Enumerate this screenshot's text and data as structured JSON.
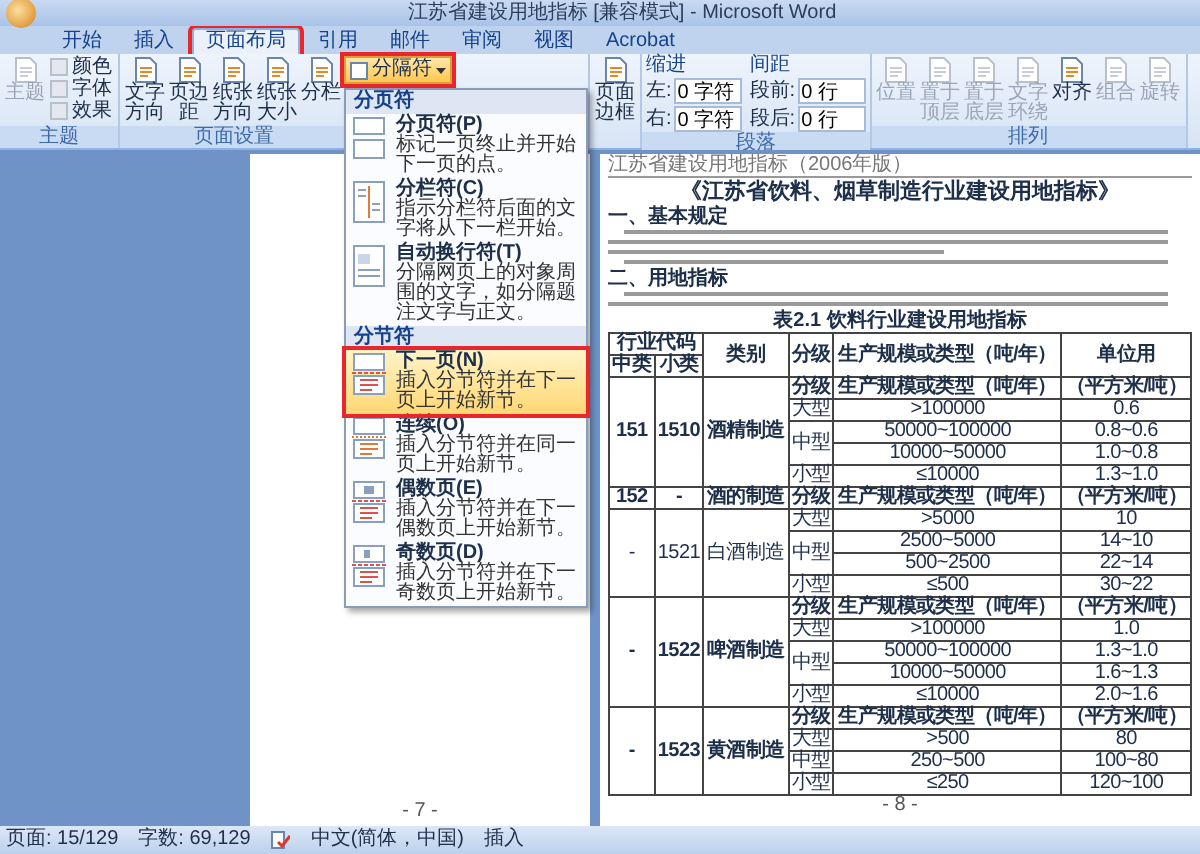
{
  "window": {
    "title": "江苏省建设用地指标 [兼容模式] - Microsoft Word"
  },
  "tabs": [
    {
      "label": "开始",
      "selected": false,
      "callout": false
    },
    {
      "label": "插入",
      "selected": false,
      "callout": false
    },
    {
      "label": "页面布局",
      "selected": true,
      "callout": true
    },
    {
      "label": "引用",
      "selected": false,
      "callout": false
    },
    {
      "label": "邮件",
      "selected": false,
      "callout": false
    },
    {
      "label": "审阅",
      "selected": false,
      "callout": false
    },
    {
      "label": "视图",
      "selected": false,
      "callout": false
    },
    {
      "label": "Acrobat",
      "selected": false,
      "callout": false
    }
  ],
  "ribbon": {
    "groups": [
      {
        "kind": "buttons",
        "label": "主题",
        "buttons": [
          {
            "kind": "big",
            "label": "主题",
            "disabled": true
          },
          {
            "kind": "small",
            "label": "颜色",
            "disabled": true
          },
          {
            "kind": "small",
            "label": "字体",
            "disabled": true
          },
          {
            "kind": "small",
            "label": "效果",
            "disabled": true
          }
        ]
      },
      {
        "kind": "buttons",
        "label": "页面设置",
        "buttons": [
          {
            "kind": "big",
            "label": "文字方向",
            "disabled": false
          },
          {
            "kind": "big",
            "label": "页边距",
            "disabled": false
          },
          {
            "kind": "big",
            "label": "纸张方向",
            "disabled": false
          },
          {
            "kind": "big",
            "label": "纸张大小",
            "disabled": false
          },
          {
            "kind": "big",
            "label": "分栏",
            "disabled": false
          },
          {
            "kind": "menu",
            "label": "分隔符",
            "disabled": false,
            "expanded": true,
            "callout": true
          }
        ]
      },
      {
        "kind": "buttons",
        "buttons": [
          {
            "kind": "big",
            "label": "页面边框",
            "disabled": false
          }
        ]
      },
      {
        "kind": "paragraph",
        "label": "段落",
        "columns": [
          {
            "heading": "缩进",
            "fields": [
              {
                "label": "左:",
                "value": "0 字符"
              },
              {
                "label": "右:",
                "value": "0 字符"
              }
            ]
          },
          {
            "heading": "间距",
            "fields": [
              {
                "label": "段前:",
                "value": "0 行"
              },
              {
                "label": "段后:",
                "value": "0 行"
              }
            ]
          }
        ]
      },
      {
        "kind": "buttons",
        "label": "排列",
        "buttons": [
          {
            "kind": "big",
            "label": "位置",
            "disabled": true
          },
          {
            "kind": "big",
            "label": "置于顶层",
            "disabled": true
          },
          {
            "kind": "big",
            "label": "置于底层",
            "disabled": true
          },
          {
            "kind": "big",
            "label": "文字环绕",
            "disabled": true
          },
          {
            "kind": "big",
            "label": "对齐",
            "disabled": false
          },
          {
            "kind": "big",
            "label": "组合",
            "disabled": true
          },
          {
            "kind": "big",
            "label": "旋转",
            "disabled": true
          }
        ]
      }
    ]
  },
  "dropdown": {
    "sections": [
      {
        "heading": "分页符",
        "items": [
          {
            "kind": "page",
            "title": "分页符(P)",
            "description": "标记一页终止并开始下一页的点。",
            "selected": false,
            "callout": false
          },
          {
            "kind": "column",
            "title": "分栏符(C)",
            "description": "指示分栏符后面的文字将从下一栏开始。",
            "selected": false,
            "callout": false
          },
          {
            "kind": "wrap",
            "title": "自动换行符(T)",
            "description": "分隔网页上的对象周围的文字，如分隔题注文字与正文。",
            "selected": false,
            "callout": false
          }
        ]
      },
      {
        "heading": "分节符",
        "items": [
          {
            "kind": "next",
            "title": "下一页(N)",
            "description": "插入分节符并在下一页上开始新节。",
            "selected": true,
            "callout": true
          },
          {
            "kind": "continuous",
            "title": "连续(O)",
            "description": "插入分节符并在同一页上开始新节。",
            "selected": false,
            "callout": false
          },
          {
            "kind": "even",
            "title": "偶数页(E)",
            "description": "插入分节符并在下一偶数页上开始新节。",
            "selected": false,
            "callout": false
          },
          {
            "kind": "odd",
            "title": "奇数页(D)",
            "description": "插入分节符并在下一奇数页上开始新节。",
            "selected": false,
            "callout": false
          }
        ]
      }
    ]
  },
  "left_page": {
    "footer": "- 7 -"
  },
  "right_page": {
    "header": "江苏省建设用地指标（2006年版）",
    "title": "《江苏省饮料、烟草制造行业建设用地指标》",
    "headings": [
      "一、基本规定",
      "二、用地指标"
    ],
    "table": {
      "caption": "表2.1 饮料行业建设用地指标",
      "header": {
        "code": "行业代码",
        "middle": "中类",
        "small": "小类",
        "category": "类别",
        "grade": "分级",
        "scale": "生产规模或类型（吨/年）",
        "unit": "单位用"
      },
      "groups": [
        {
          "middle": "151",
          "small": "1510",
          "category": "酒精制造",
          "rows": [
            {
              "kind": "subheader",
              "grade": "分级",
              "scale": "生产规模或类型（吨/年）",
              "unit": "（平方米/吨）"
            },
            {
              "kind": "value",
              "grade": "大型",
              "scale": ">100000",
              "unit": "0.6"
            },
            {
              "kind": "value",
              "grade": "中型",
              "scale": "50000~100000",
              "unit": "0.8~0.6"
            },
            {
              "kind": "value",
              "scale": "10000~50000",
              "unit": "1.0~0.8"
            },
            {
              "kind": "value",
              "grade": "小型",
              "scale": "≤10000",
              "unit": "1.3~1.0"
            }
          ]
        },
        {
          "middle": "152",
          "small": "-",
          "category": "酒的制造",
          "rows": [
            {
              "kind": "subheader",
              "grade": "分级",
              "scale": "生产规模或类型（吨/年）",
              "unit": "（平方米/吨）"
            }
          ]
        },
        {
          "middle": "-",
          "small": "1521",
          "category": "白酒制造",
          "rows": [
            {
              "kind": "value",
              "grade": "大型",
              "scale": ">5000",
              "unit": "10"
            },
            {
              "kind": "value",
              "grade": "中型",
              "scale": "2500~5000",
              "unit": "14~10"
            },
            {
              "kind": "value",
              "scale": "500~2500",
              "unit": "22~14"
            },
            {
              "kind": "value",
              "grade": "小型",
              "scale": "≤500",
              "unit": "30~22"
            }
          ]
        },
        {
          "middle": "-",
          "small": "1522",
          "category": "啤酒制造",
          "rows": [
            {
              "kind": "subheader",
              "grade": "分级",
              "scale": "生产规模或类型（吨/年）",
              "unit": "（平方米/吨）"
            },
            {
              "kind": "value",
              "grade": "大型",
              "scale": ">100000",
              "unit": "1.0"
            },
            {
              "kind": "value",
              "grade": "中型",
              "scale": "50000~100000",
              "unit": "1.3~1.0"
            },
            {
              "kind": "value",
              "scale": "10000~50000",
              "unit": "1.6~1.3"
            },
            {
              "kind": "value",
              "grade": "小型",
              "scale": "≤10000",
              "unit": "2.0~1.6"
            }
          ]
        },
        {
          "middle": "-",
          "small": "1523",
          "category": "黄酒制造",
          "rows": [
            {
              "kind": "subheader",
              "grade": "分级",
              "scale": "生产规模或类型（吨/年）",
              "unit": "（平方米/吨）"
            },
            {
              "kind": "value",
              "grade": "大型",
              "scale": ">500",
              "unit": "80"
            },
            {
              "kind": "value",
              "grade": "中型",
              "scale": "250~500",
              "unit": "100~80"
            },
            {
              "kind": "value",
              "grade": "小型",
              "scale": "≤250",
              "unit": "120~100"
            }
          ]
        }
      ]
    },
    "footer": "- 8 -"
  },
  "status_bar": {
    "page": "页面: 15/129",
    "words": "字数: 69,129",
    "language": "中文(简体，中国)",
    "mode": "插入"
  }
}
